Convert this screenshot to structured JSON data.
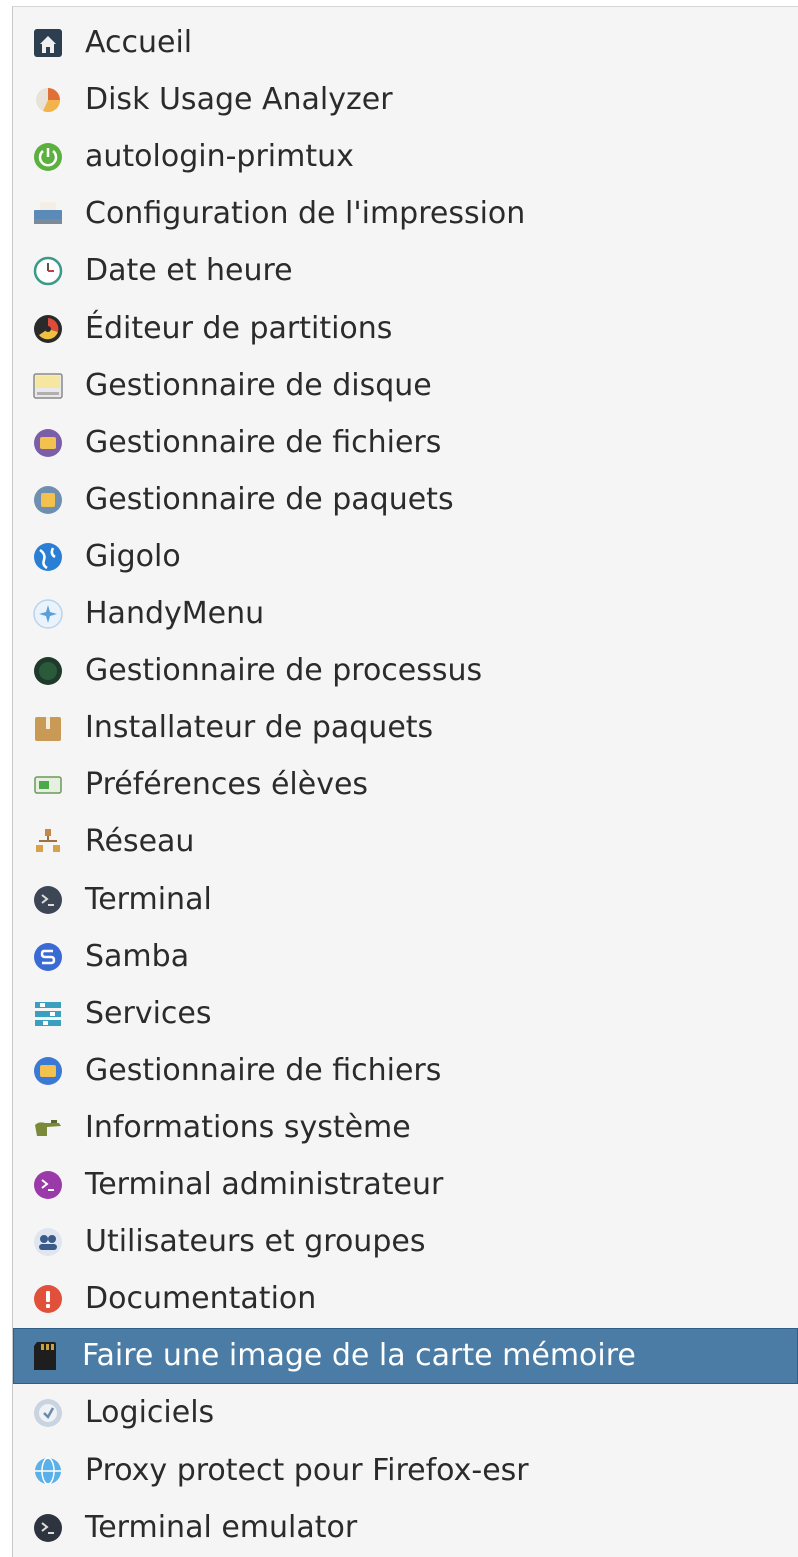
{
  "menu": {
    "items": [
      {
        "label": "Accueil",
        "icon": "home-icon"
      },
      {
        "label": "Disk Usage Analyzer",
        "icon": "disk-usage-icon"
      },
      {
        "label": "autologin-primtux",
        "icon": "power-icon"
      },
      {
        "label": "Configuration de l'impression",
        "icon": "printer-icon"
      },
      {
        "label": "Date et heure",
        "icon": "clock-icon"
      },
      {
        "label": "Éditeur de partitions",
        "icon": "partition-editor-icon"
      },
      {
        "label": "Gestionnaire de disque",
        "icon": "disk-manager-icon"
      },
      {
        "label": "Gestionnaire de fichiers",
        "icon": "file-manager-icon"
      },
      {
        "label": "Gestionnaire de paquets",
        "icon": "package-manager-icon"
      },
      {
        "label": "Gigolo",
        "icon": "globe-icon"
      },
      {
        "label": "HandyMenu",
        "icon": "handymenu-icon"
      },
      {
        "label": "Gestionnaire de processus",
        "icon": "process-manager-icon"
      },
      {
        "label": "Installateur de paquets",
        "icon": "package-box-icon"
      },
      {
        "label": "Préférences élèves",
        "icon": "preferences-icon"
      },
      {
        "label": "Réseau",
        "icon": "network-icon"
      },
      {
        "label": "Terminal",
        "icon": "terminal-icon"
      },
      {
        "label": "Samba",
        "icon": "samba-icon"
      },
      {
        "label": "Services",
        "icon": "services-icon"
      },
      {
        "label": "Gestionnaire de fichiers",
        "icon": "file-manager-blue-icon"
      },
      {
        "label": "Informations système",
        "icon": "system-info-icon"
      },
      {
        "label": "Terminal administrateur",
        "icon": "admin-terminal-icon"
      },
      {
        "label": "Utilisateurs et groupes",
        "icon": "users-groups-icon"
      },
      {
        "label": "Documentation",
        "icon": "documentation-icon"
      },
      {
        "label": "Faire une image de la carte mémoire",
        "icon": "sd-card-icon",
        "selected": true
      },
      {
        "label": "Logiciels",
        "icon": "software-icon"
      },
      {
        "label": "Proxy protect pour Firefox-esr",
        "icon": "proxy-globe-icon"
      },
      {
        "label": "Terminal emulator",
        "icon": "terminal-emulator-icon"
      }
    ],
    "selected_color": "#4a7ca6"
  }
}
